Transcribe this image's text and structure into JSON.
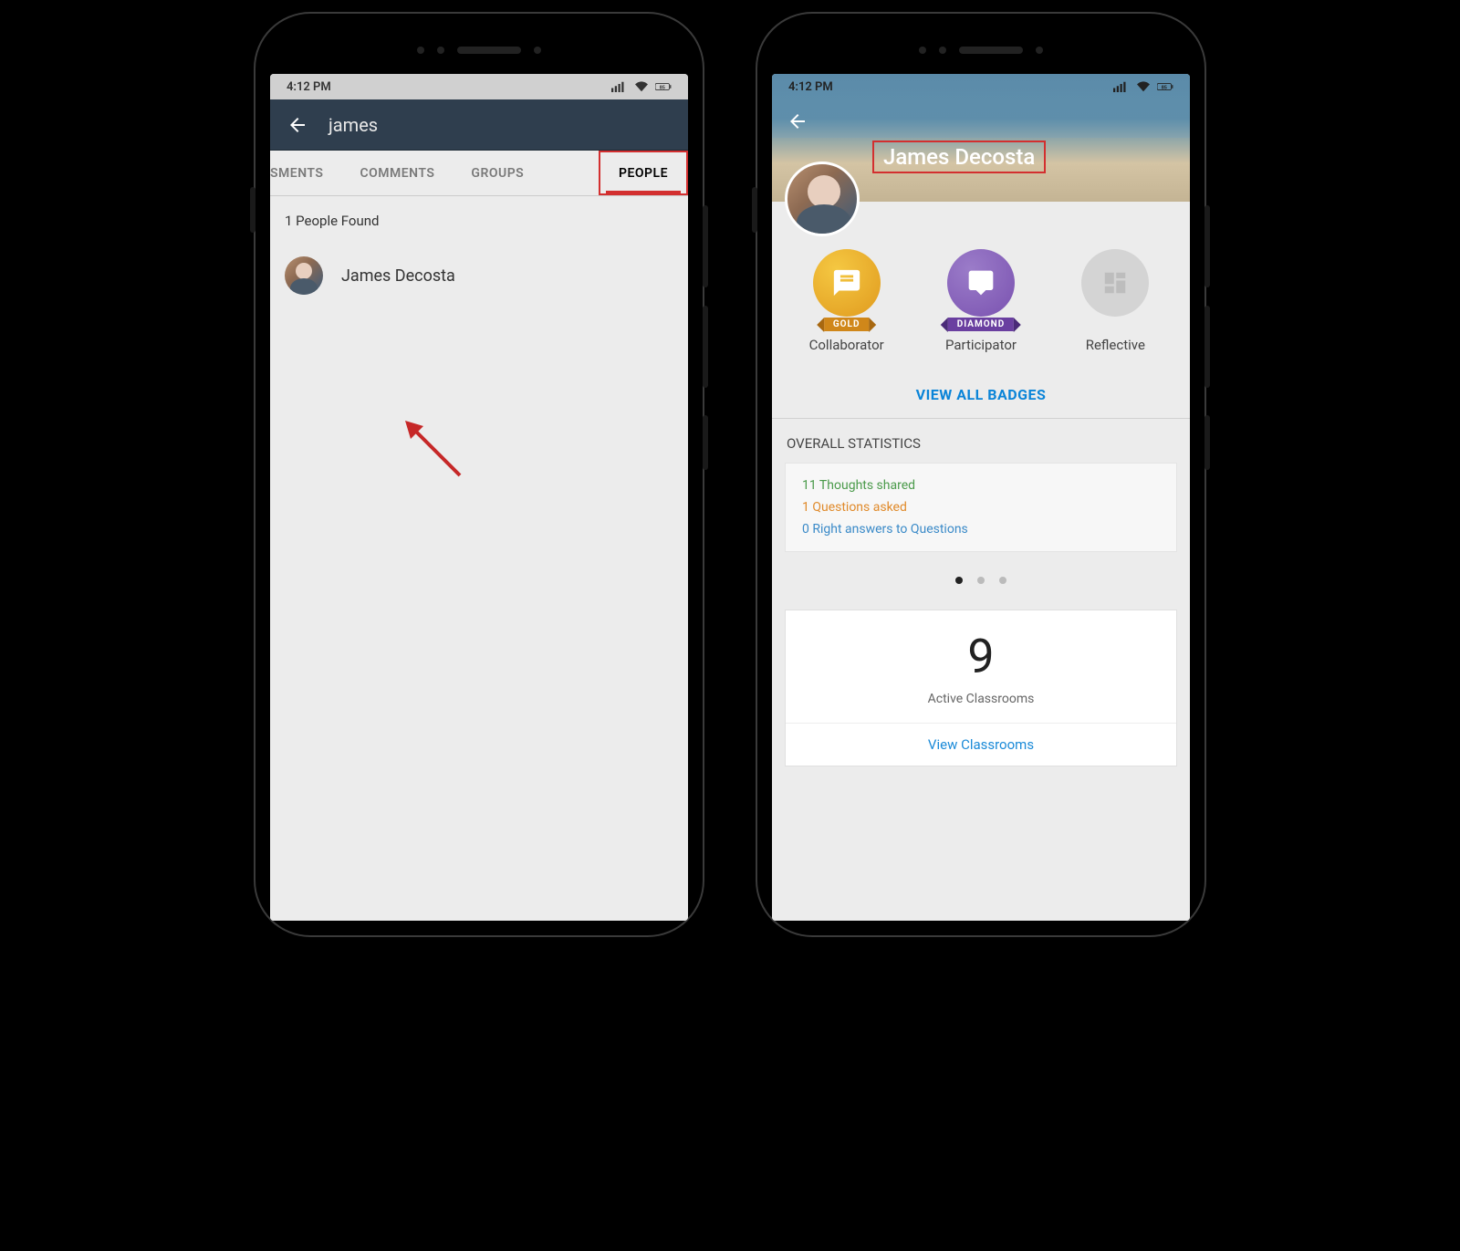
{
  "status": {
    "time": "4:12 PM",
    "battery": "85"
  },
  "left": {
    "search_query": "james",
    "tabs": {
      "partial": "SMENTS",
      "comments": "COMMENTS",
      "groups": "GROUPS",
      "people": "PEOPLE"
    },
    "found_label": "1 People Found",
    "result_name": "James Decosta"
  },
  "right": {
    "profile_name": "James Decosta",
    "badges": [
      {
        "tier": "GOLD",
        "label": "Collaborator",
        "icon": "chat-icon"
      },
      {
        "tier": "DIAMOND",
        "label": "Participator",
        "icon": "speech-icon"
      },
      {
        "tier": "",
        "label": "Reflective",
        "icon": "grid-icon"
      }
    ],
    "view_all_badges": "VIEW ALL BADGES",
    "stats_title": "OVERALL STATISTICS",
    "stats": {
      "thoughts": "11 Thoughts shared",
      "questions": "1 Questions asked",
      "answers": "0 Right answers to Questions"
    },
    "classrooms": {
      "count": "9",
      "label": "Active Classrooms",
      "link": "View Classrooms"
    }
  }
}
